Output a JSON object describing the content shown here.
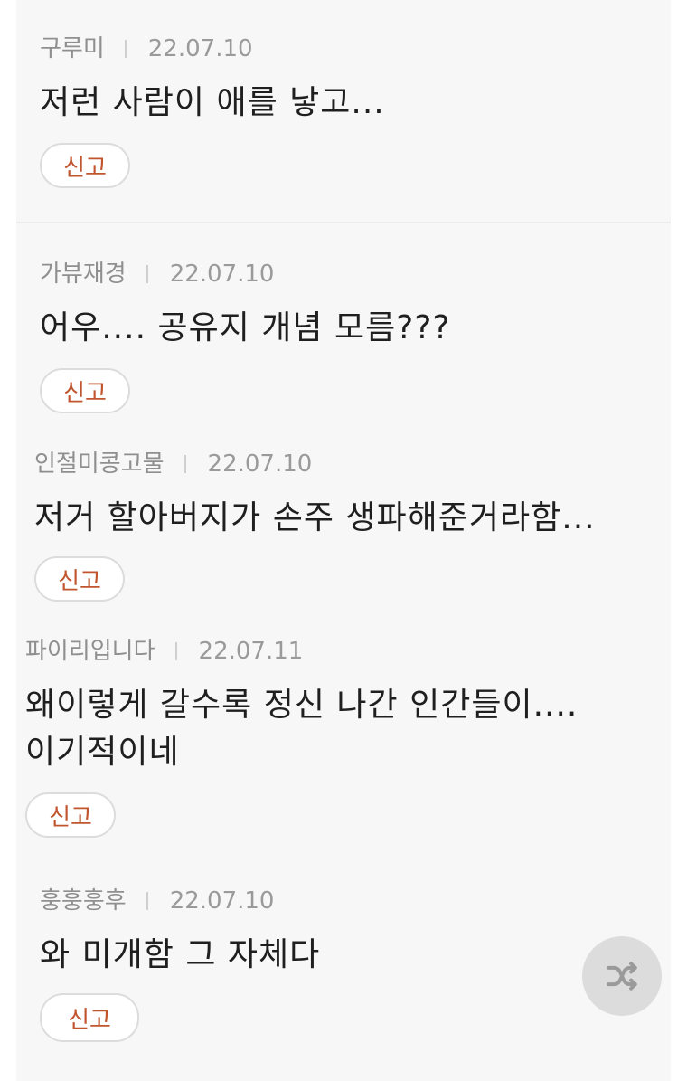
{
  "comments": [
    {
      "author": "구루미",
      "date": "22.07.10",
      "text": "저런 사람이 애를 낳고...",
      "report_label": "신고"
    },
    {
      "author": "가뷰재경",
      "date": "22.07.10",
      "text": "어우.... 공유지 개념 모름???",
      "report_label": "신고"
    },
    {
      "author": "인절미콩고물",
      "date": "22.07.10",
      "text": "저거 할아버지가 손주 생파해준거라함...",
      "report_label": "신고"
    },
    {
      "author": "파이리입니다",
      "date": "22.07.11",
      "text": "왜이렇게 갈수록 정신 나간 인간들이....\n이기적이네",
      "report_label": "신고"
    },
    {
      "author": "훙훙훙후",
      "date": "22.07.10",
      "text": "와 미개함 그 자체다",
      "report_label": "신고"
    }
  ],
  "floating_action": {
    "icon": "shuffle-icon",
    "color": "#dcdcdc"
  },
  "colors": {
    "report_text": "#c0552e",
    "card_background": "#f7f7f7"
  }
}
